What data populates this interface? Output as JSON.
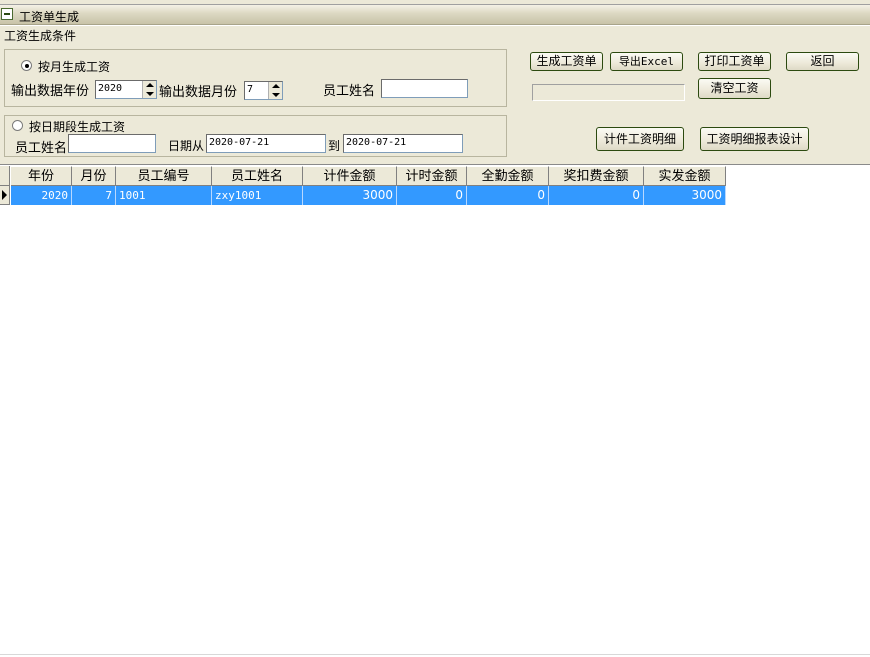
{
  "window": {
    "title": "工资单生成"
  },
  "conditions": {
    "group_label": "工资生成条件",
    "by_month": {
      "radio_label": "按月生成工资",
      "selected": true,
      "year_label": "输出数据年份",
      "year_value": "2020",
      "month_label": "输出数据月份",
      "month_value": "7",
      "name_label": "员工姓名",
      "name_value": ""
    },
    "by_date": {
      "radio_label": "按日期段生成工资",
      "selected": false,
      "name_label": "员工姓名",
      "name_value": "",
      "from_label": "日期从",
      "from_value": "2020-07-21",
      "to_label": "到",
      "to_value": "2020-07-21"
    }
  },
  "toolbar": {
    "generate_label": "生成工资单",
    "export_label": "导出Excel",
    "print_label": "打印工资单",
    "back_label": "返回",
    "clear_label": "清空工资",
    "piece_detail_label": "计件工资明细",
    "report_design_label": "工资明细报表设计"
  },
  "table": {
    "columns": [
      "年份",
      "月份",
      "员工编号",
      "员工姓名",
      "计件金额",
      "计时金额",
      "全勤金额",
      "奖扣费金额",
      "实发金额"
    ],
    "rows": [
      {
        "year": "2020",
        "month": "7",
        "emp_id": "1001",
        "emp_name": "zxy1001",
        "piece": "3000",
        "hourly": "0",
        "attendance": "0",
        "bonus": "0",
        "net": "3000"
      }
    ]
  },
  "colors": {
    "panel": "#ece9d8",
    "selected_row": "#3399ff",
    "button_border": "#2c4a10"
  }
}
